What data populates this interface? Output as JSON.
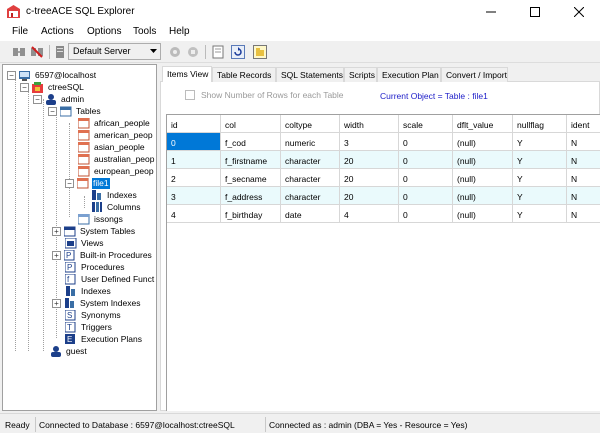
{
  "window": {
    "title": "c-treeACE SQL Explorer"
  },
  "menu": [
    "File",
    "Actions",
    "Options",
    "Tools",
    "Help"
  ],
  "toolbar": {
    "server_select": "Default Server"
  },
  "tree": [
    {
      "label": "6597@localhost",
      "icon": "server-icon",
      "selected": false
    },
    {
      "label": "ctreeSQL",
      "icon": "database-icon",
      "selected": false
    },
    {
      "label": "admin",
      "icon": "user-icon",
      "selected": false
    },
    {
      "label": "Tables",
      "icon": "tables-folder-icon",
      "selected": false
    },
    {
      "label": "african_people",
      "icon": "table-icon",
      "selected": false
    },
    {
      "label": "american_peop",
      "icon": "table-icon",
      "selected": false
    },
    {
      "label": "asian_people",
      "icon": "table-icon",
      "selected": false
    },
    {
      "label": "australian_peop",
      "icon": "table-icon",
      "selected": false
    },
    {
      "label": "european_peop",
      "icon": "table-icon",
      "selected": false
    },
    {
      "label": "file1",
      "icon": "table-icon",
      "selected": true
    },
    {
      "label": "Indexes",
      "icon": "indexes-icon",
      "selected": false
    },
    {
      "label": "Columns",
      "icon": "columns-icon",
      "selected": false
    },
    {
      "label": "issongs",
      "icon": "table-icon",
      "selected": false
    },
    {
      "label": "System Tables",
      "icon": "system-tables-icon",
      "selected": false
    },
    {
      "label": "Views",
      "icon": "views-icon",
      "selected": false
    },
    {
      "label": "Built-in Procedures",
      "icon": "procedures-icon",
      "selected": false
    },
    {
      "label": "Procedures",
      "icon": "procedures-icon",
      "selected": false
    },
    {
      "label": "User Defined Funct",
      "icon": "functions-icon",
      "selected": false
    },
    {
      "label": "Indexes",
      "icon": "indexes-icon",
      "selected": false
    },
    {
      "label": "System Indexes",
      "icon": "indexes-icon",
      "selected": false
    },
    {
      "label": "Synonyms",
      "icon": "synonyms-icon",
      "selected": false
    },
    {
      "label": "Triggers",
      "icon": "triggers-icon",
      "selected": false
    },
    {
      "label": "Execution Plans",
      "icon": "execution-plans-icon",
      "selected": false
    },
    {
      "label": "guest",
      "icon": "user-icon",
      "selected": false
    }
  ],
  "tabs": [
    {
      "label": "Items View",
      "active": true
    },
    {
      "label": "Table Records",
      "active": false
    },
    {
      "label": "SQL Statements",
      "active": false
    },
    {
      "label": "Scripts",
      "active": false
    },
    {
      "label": "Execution Plan",
      "active": false
    },
    {
      "label": "Convert / Import",
      "active": false
    }
  ],
  "items_view": {
    "checkbox_label": "Show Number of Rows for each Table",
    "current_object": "Current Object = Table : file1"
  },
  "grid": {
    "columns": [
      "id",
      "col",
      "coltype",
      "width",
      "scale",
      "dflt_value",
      "nullflag",
      "ident"
    ],
    "rows": [
      [
        "0",
        "f_cod",
        "numeric",
        "3",
        "0",
        "(null)",
        "Y",
        "N"
      ],
      [
        "1",
        "f_firstname",
        "character",
        "20",
        "0",
        "(null)",
        "Y",
        "N"
      ],
      [
        "2",
        "f_secname",
        "character",
        "20",
        "0",
        "(null)",
        "Y",
        "N"
      ],
      [
        "3",
        "f_address",
        "character",
        "20",
        "0",
        "(null)",
        "Y",
        "N"
      ],
      [
        "4",
        "f_birthday",
        "date",
        "4",
        "0",
        "(null)",
        "Y",
        "N"
      ]
    ]
  },
  "status": {
    "ready": "Ready",
    "connection": "Connected to Database : 6597@localhost:ctreeSQL",
    "user": "Connected as : admin (DBA = Yes - Resource = Yes)"
  },
  "colors": {
    "selection": "#0078d7",
    "alt_row": "#eafafc",
    "current_object": "#1c1cc8"
  }
}
